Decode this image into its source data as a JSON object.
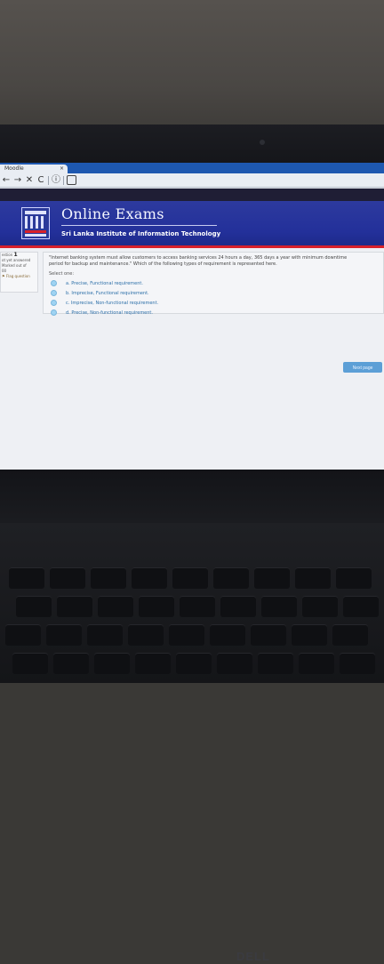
{
  "browser": {
    "tab_title": "Moodle",
    "tab_close": "×",
    "toolbar": {
      "back": "←",
      "forward": "→",
      "stop": "✕",
      "reload": "C",
      "info": "ⓘ",
      "page": "🗎"
    }
  },
  "header": {
    "title": "Online Exams",
    "subtitle": "Sri Lanka Institute of Information Technology"
  },
  "quiz_nav": {
    "question_label": "estion",
    "question_number": "1",
    "status": "ot yet answered",
    "marks": "Marked out of",
    "marks_value": "00",
    "flag": "Flag question"
  },
  "question": {
    "text": "\"Internet banking system must allow customers to access banking services 24 hours a day, 365 days a year with minimum downtime period for backup and maintenance.\" Which of the following types of requirement is represented here.",
    "select_label": "Select one:",
    "options": [
      "a. Precise, Functional requirement.",
      "b. Imprecise, Functional requirement.",
      "c. Imprecise, Non-functional requirement.",
      "d. Precise, Non-functional requirement."
    ]
  },
  "actions": {
    "next_label": "Next page"
  },
  "device": {
    "brand": "DELL"
  },
  "colors": {
    "header_blue": "#23309a",
    "header_red_rule": "#d8212b",
    "tab_strip": "#1e58b0",
    "option_link": "#2c6fa8",
    "next_button": "#5c9fd6"
  }
}
